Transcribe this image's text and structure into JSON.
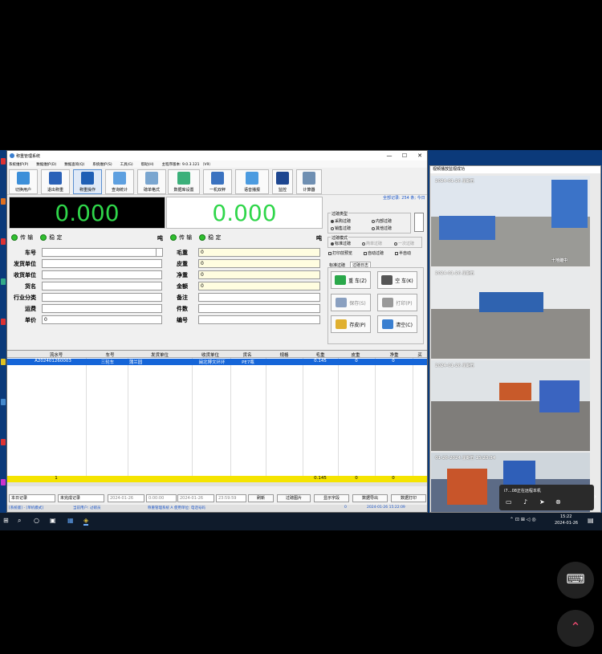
{
  "window": {
    "title": "称重管理系统",
    "min": "—",
    "max": "☐",
    "close": "✕"
  },
  "menu": [
    "系统维护(P)",
    "数据维护(D)",
    "数据查询(Q)",
    "系统维护(S)",
    "工具(G)",
    "帮助(H)",
    "主程序版本: 9.0.3.121 （V9）"
  ],
  "toolbar": [
    {
      "label": "切换用户",
      "icon": "switch-user-icon",
      "color": "#3c8fd9"
    },
    {
      "label": "退出称重",
      "icon": "logout-icon",
      "color": "#2b62b8"
    },
    {
      "label": "称重操作",
      "icon": "weigh-icon",
      "color": "#1f5fb5"
    },
    {
      "label": "查询统计",
      "icon": "query-icon",
      "color": "#5ea0e0"
    },
    {
      "label": "磅单格式",
      "icon": "format-icon",
      "color": "#7aa6d0"
    },
    {
      "label": "数据库设置",
      "icon": "database-icon",
      "color": "#3bb07a"
    },
    {
      "label": "一机双秤",
      "icon": "dual-scale-icon",
      "color": "#3a72c0"
    },
    {
      "label": "语音播报",
      "icon": "speaker-icon",
      "color": "#4b9be0"
    },
    {
      "label": "监控",
      "icon": "monitor-icon",
      "color": "#1d4690"
    },
    {
      "label": "计算器",
      "icon": "calculator-icon",
      "color": "#6f8fb2"
    }
  ],
  "summary": "全部记录: 254 条; 今日",
  "scale1": "0.000",
  "scale2": "0.000",
  "status": {
    "transmit": "传 输",
    "stable": "稳 定",
    "unit": "吨"
  },
  "left_fields": [
    {
      "label": "车号",
      "value": ""
    },
    {
      "label": "发货单位",
      "value": ""
    },
    {
      "label": "收货单位",
      "value": ""
    },
    {
      "label": "货名",
      "value": ""
    },
    {
      "label": "行业分类",
      "value": ""
    },
    {
      "label": "运费",
      "value": ""
    },
    {
      "label": "单价",
      "value": "0"
    }
  ],
  "right_fields": [
    {
      "label": "毛重",
      "value": "0"
    },
    {
      "label": "皮重",
      "value": "0"
    },
    {
      "label": "净重",
      "value": "0"
    },
    {
      "label": "金额",
      "value": "0"
    },
    {
      "label": "备注",
      "value": ""
    },
    {
      "label": "件数",
      "value": ""
    },
    {
      "label": "编号",
      "value": ""
    }
  ],
  "weigh_type": {
    "title": "过磅类型",
    "options": [
      "采购过磅",
      "内部过磅",
      "销售过磅",
      "其他过磅"
    ],
    "selected": 0
  },
  "weigh_mode": {
    "title": "过磅模式",
    "options": [
      "标准过磅",
      "简单过磅",
      "一次过磅"
    ],
    "selected": 0
  },
  "checks": [
    "打印前预览",
    "自动过磅",
    "半自动"
  ],
  "tabs": [
    "标准过磅",
    "过磅日志"
  ],
  "actions": [
    {
      "label": "重 车(Z)",
      "color": "#2aa84a"
    },
    {
      "label": "空 车(K)",
      "color": "#555"
    },
    {
      "label": "保存(S)",
      "color": "#8aa0c0"
    },
    {
      "label": "打印(P)",
      "color": "#999"
    },
    {
      "label": "存皮(P)",
      "color": "#e0b030"
    },
    {
      "label": "清空(C)",
      "color": "#3a7fd0"
    }
  ],
  "grid": {
    "headers": [
      "流水号",
      "车号",
      "发货单位",
      "收货单位",
      "货名",
      "规格",
      "毛重",
      "皮重",
      "净重",
      "买"
    ],
    "row": [
      "A202401260003",
      "三轮车",
      "蒲兰园",
      "闽北博文环环",
      "PE7瓶",
      "",
      "0.145",
      "0",
      "0",
      ""
    ],
    "total": [
      "1",
      "",
      "",
      "",
      "",
      "",
      "0.145",
      "0",
      "0",
      ""
    ]
  },
  "bottom": {
    "filter1": "本日记录",
    "filter2": "未完成记录",
    "date1": "2024-01-26",
    "time1": "0:00:00",
    "date2": "2024-01-26",
    "time2": "23:59:59",
    "refresh": "刷新",
    "photo": "过磅图片",
    "show_fields": "显示字段",
    "export": "数据导出",
    "print": "数据打印"
  },
  "statusbar": [
    "[系统版] - [单机模式]",
    "当前用户: 过磅员",
    "称重管理系统 A 使用单位: 电话号码",
    "0",
    "2024-01-26 15:22:09"
  ],
  "camera": {
    "title": "视频播放监视成功",
    "feeds": [
      {
        "ts": "2024-01-26 星期五",
        "caption": "十地建中"
      },
      {
        "ts": "2024-01-26 星期五",
        "caption": ""
      },
      {
        "ts": "2024-01-26 星期五",
        "caption": ""
      },
      {
        "ts": "01-26-2024  星期五  15:23:34",
        "caption": ""
      }
    ]
  },
  "remote": {
    "text": "i7…08正在远程本机"
  },
  "taskbar": {
    "time": "15:22",
    "date": "2024-01-26"
  },
  "overlay": {
    "keyboard": "⌨",
    "updown": "⌃"
  }
}
